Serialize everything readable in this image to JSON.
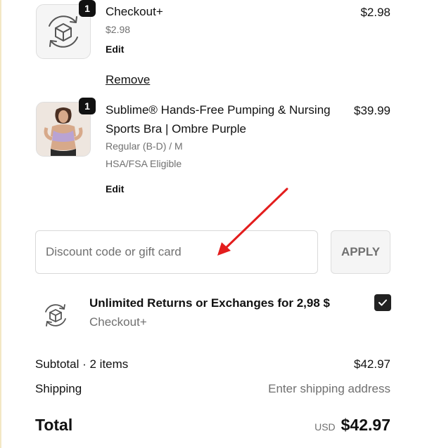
{
  "items": [
    {
      "quantity": "1",
      "title": "Checkout+",
      "variant": "$2.98",
      "edit_label": "Edit",
      "price": "$2.98",
      "remove_label": "Remove",
      "icon": "box-returns-icon"
    },
    {
      "quantity": "1",
      "title_line1": "Sublime® Hands-Free Pumping & Nursing",
      "title_line2": "Sports Bra | Ombre Purple",
      "variant": "Regular (B-D) / M",
      "eligibility": "HSA/FSA Eligible",
      "edit_label": "Edit",
      "price": "$39.99"
    }
  ],
  "discount": {
    "placeholder": "Discount code or gift card",
    "apply_label": "APPLY"
  },
  "upsell": {
    "title": "Unlimited Returns or Exchanges for 2,98 $",
    "subtitle": "Checkout+",
    "checked": true,
    "icon": "box-returns-icon"
  },
  "summary": {
    "subtotal_label": "Subtotal · 2 items",
    "subtotal_value": "$42.97",
    "shipping_label": "Shipping",
    "shipping_value": "Enter shipping address",
    "total_label": "Total",
    "currency": "USD",
    "total_value": "$42.97"
  },
  "annotation": {
    "arrow_color": "#e31d1d"
  }
}
